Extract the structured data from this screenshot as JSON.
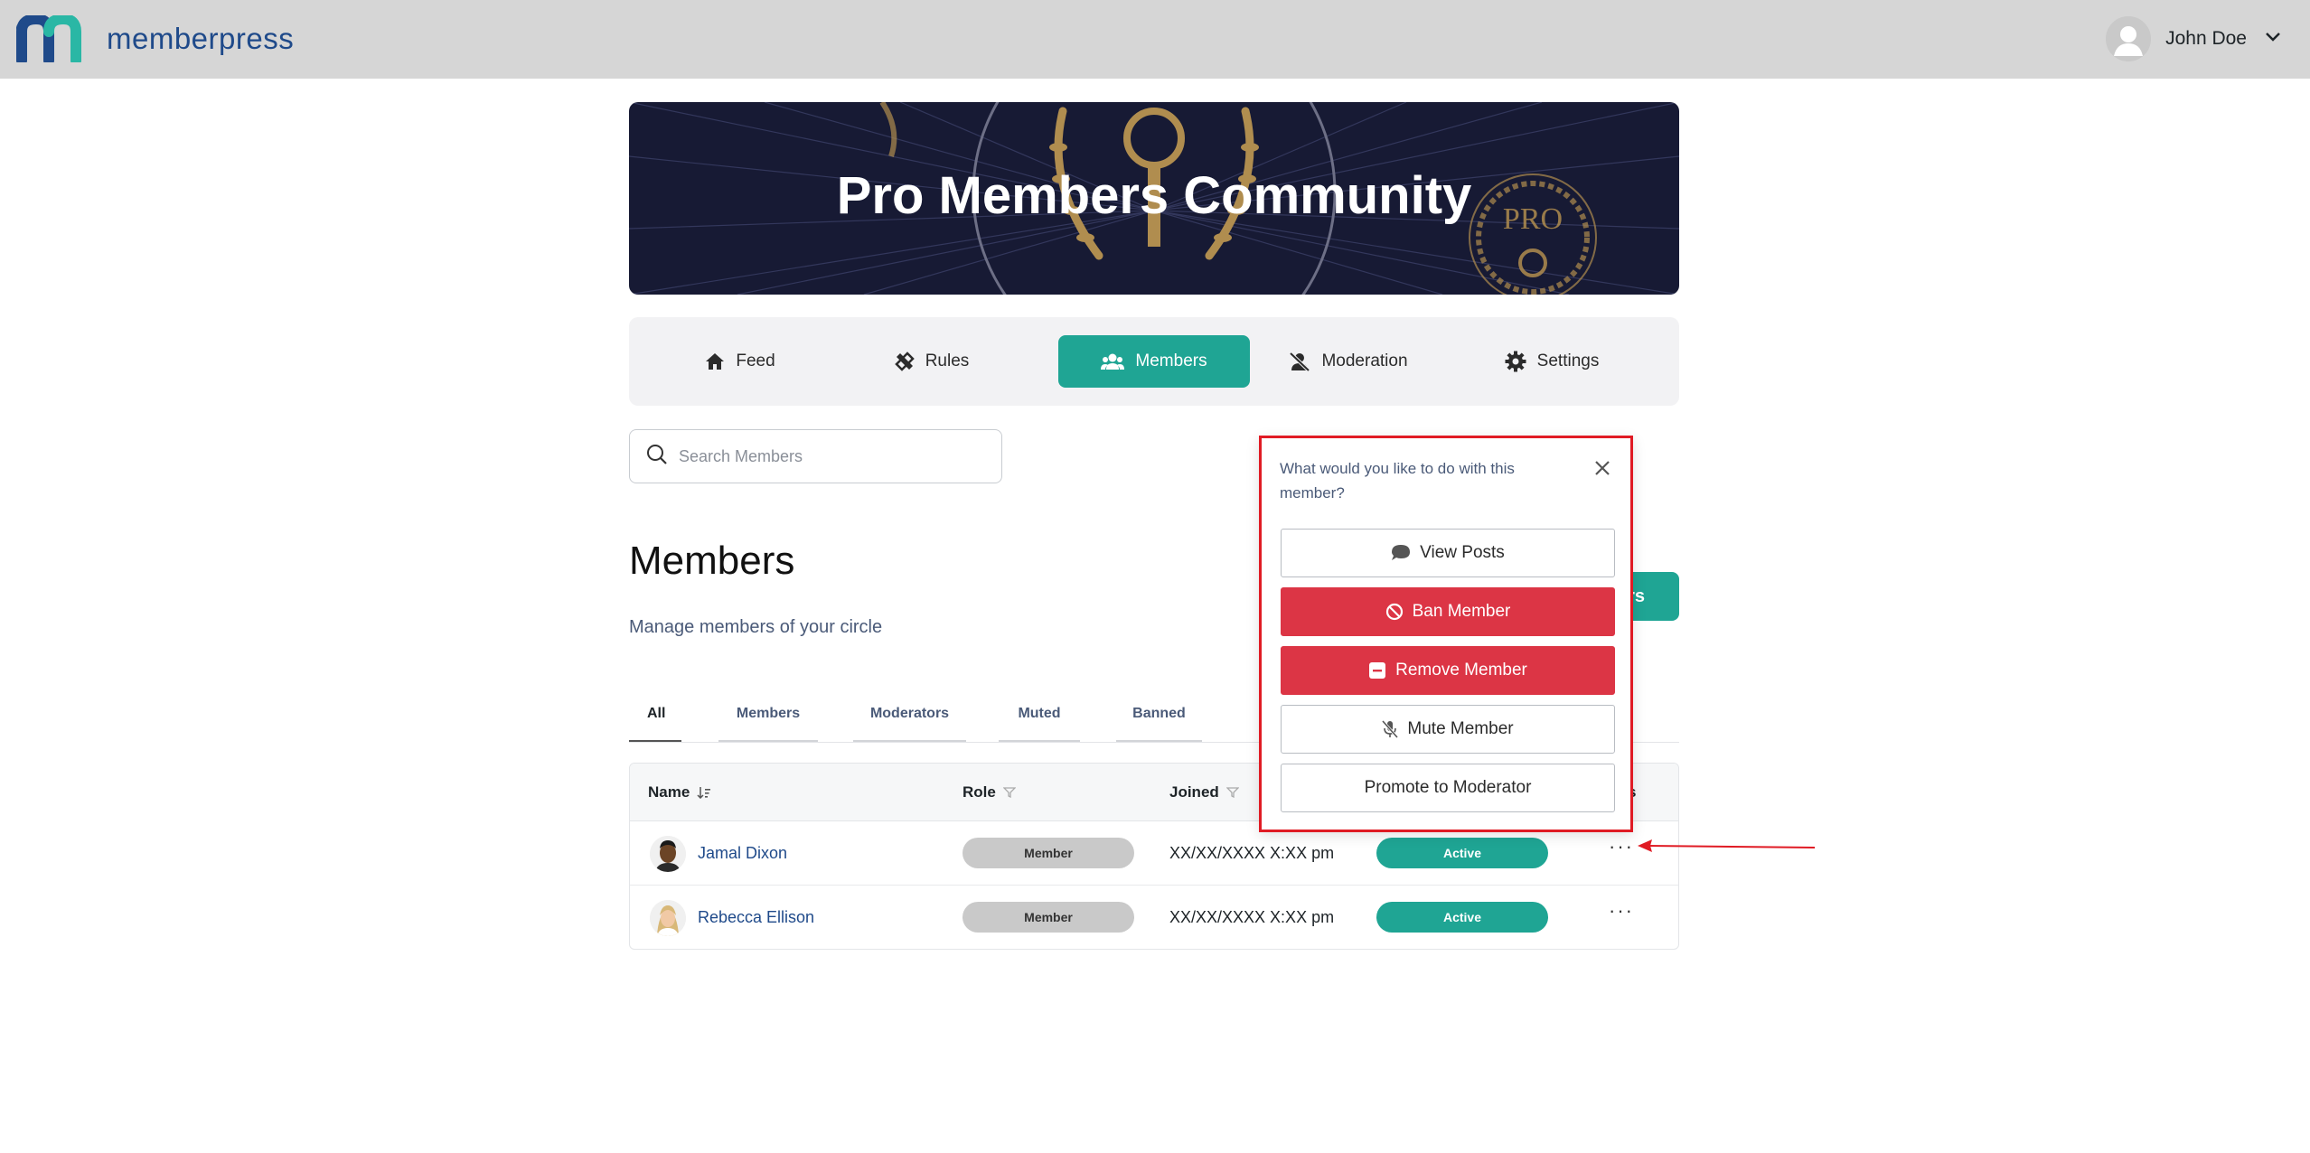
{
  "header": {
    "logo_text": "memberpress",
    "user_name": "John Doe"
  },
  "banner": {
    "title": "Pro Members Community"
  },
  "nav_tabs": [
    {
      "label": "Feed",
      "icon": "home-icon"
    },
    {
      "label": "Rules",
      "icon": "rules-icon"
    },
    {
      "label": "Members",
      "icon": "members-icon",
      "active": true
    },
    {
      "label": "Moderation",
      "icon": "moderation-icon"
    },
    {
      "label": "Settings",
      "icon": "gear-icon"
    }
  ],
  "search": {
    "placeholder": "Search Members"
  },
  "members_section": {
    "title": "Members",
    "subtitle": "Manage members of your circle",
    "button_tail": "ers"
  },
  "filter_tabs": [
    {
      "label": "All",
      "active": true
    },
    {
      "label": "Members"
    },
    {
      "label": "Moderators"
    },
    {
      "label": "Muted"
    },
    {
      "label": "Banned"
    }
  ],
  "table": {
    "columns": [
      "Name",
      "Role",
      "Joined",
      "s"
    ],
    "rows": [
      {
        "name": "Jamal Dixon",
        "role": "Member",
        "joined": "XX/XX/XXXX X:XX pm",
        "status": "Active"
      },
      {
        "name": "Rebecca Ellison",
        "role": "Member",
        "joined": "XX/XX/XXXX X:XX pm",
        "status": "Active"
      }
    ],
    "actions_label": "···"
  },
  "popup": {
    "question": "What would you like to do with this member?",
    "buttons": [
      {
        "label": "View Posts",
        "style": "outline",
        "icon": "speech-bubble-icon"
      },
      {
        "label": "Ban Member",
        "style": "danger",
        "icon": "ban-icon"
      },
      {
        "label": "Remove Member",
        "style": "danger",
        "icon": "minus-square-icon"
      },
      {
        "label": "Mute Member",
        "style": "outline",
        "icon": "mic-off-icon"
      },
      {
        "label": "Promote to Moderator",
        "style": "outline",
        "icon": ""
      }
    ]
  },
  "colors": {
    "accent": "#1fa594",
    "danger": "#dc3545",
    "highlight_border": "#e01b24",
    "topbar": "#d6d6d6"
  }
}
